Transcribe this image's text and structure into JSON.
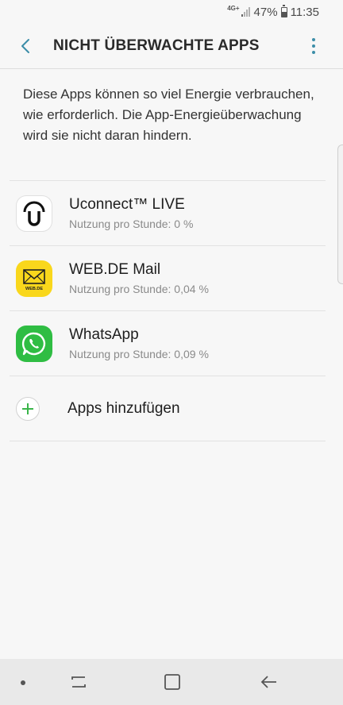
{
  "status_bar": {
    "network": "4G+",
    "battery": "47%",
    "battery_level": 0.47,
    "time": "11:35"
  },
  "header": {
    "title": "NICHT ÜBERWACHTE APPS",
    "back_icon": "back-arrow-icon",
    "more_icon": "more-vert-icon",
    "accent_color": "#3c8ea8"
  },
  "description": "Diese Apps können so viel Energie verbrauchen, wie erforderlich. Die App-Energieüberwachung wird sie nicht daran hindern.",
  "apps": [
    {
      "name": "Uconnect™ LIVE",
      "usage": "Nutzung pro Stunde: 0 %",
      "icon": "uconnect-icon"
    },
    {
      "name": "WEB.DE Mail",
      "usage": "Nutzung pro Stunde: 0,04 %",
      "icon": "webde-mail-icon",
      "icon_text": "WEB.DE"
    },
    {
      "name": "WhatsApp",
      "usage": "Nutzung pro Stunde: 0,09 %",
      "icon": "whatsapp-icon"
    }
  ],
  "add_apps": {
    "label": "Apps hinzufügen",
    "icon": "plus-icon",
    "color": "#3ab54a"
  },
  "nav_bar": {
    "recent_icon": "recent-apps-icon",
    "home_icon": "home-icon",
    "back_icon": "back-icon"
  }
}
